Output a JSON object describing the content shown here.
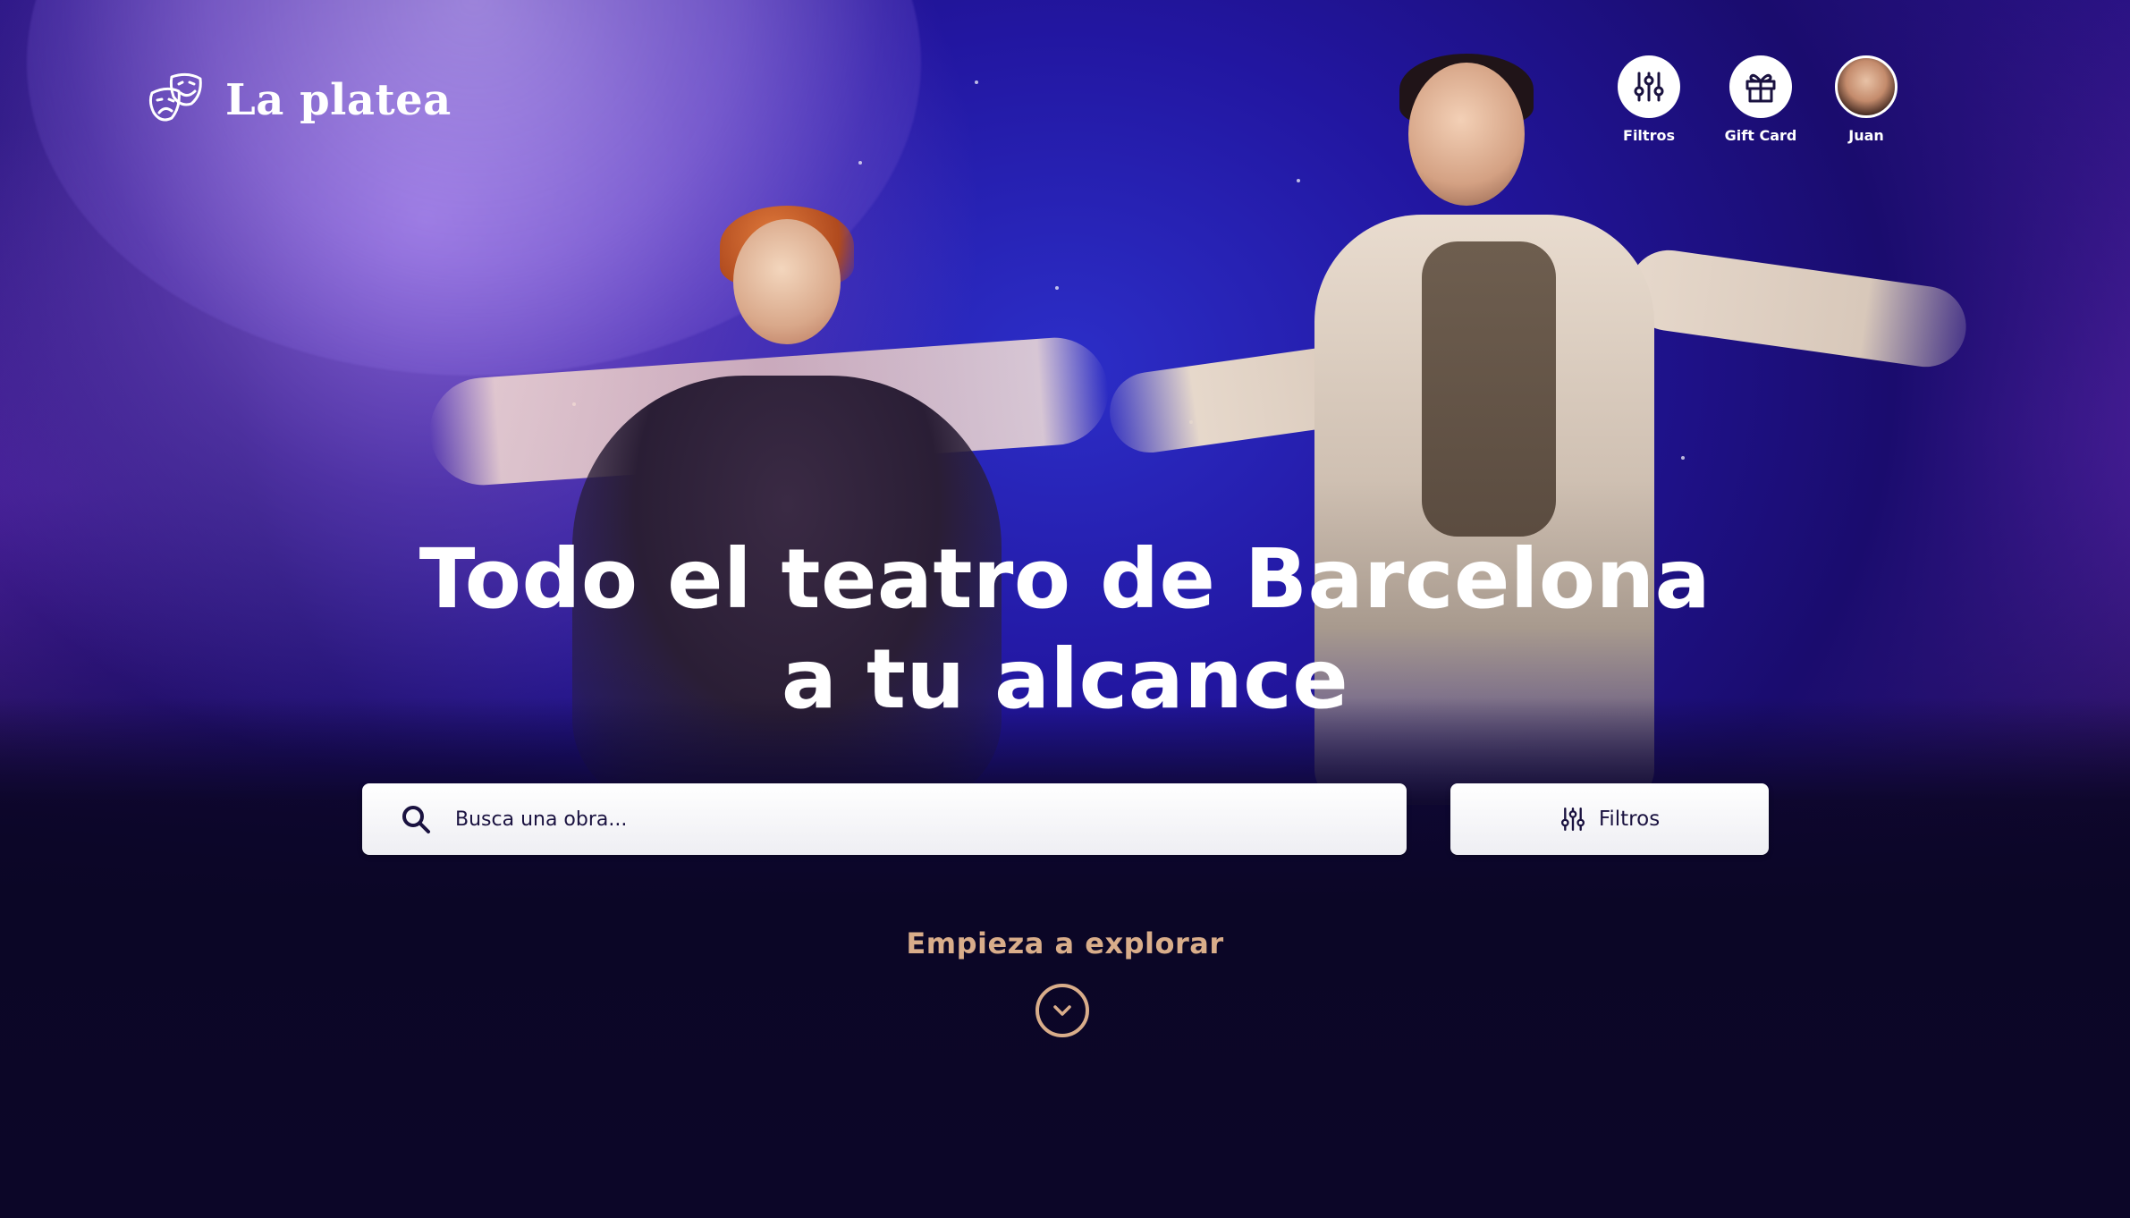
{
  "app": {
    "brand": "La platea"
  },
  "nav": {
    "items": [
      {
        "label": "Filtros",
        "icon": "sliders-icon"
      },
      {
        "label": "Gift Card",
        "icon": "gift-icon"
      },
      {
        "label": "Juan",
        "icon": "avatar"
      }
    ]
  },
  "hero": {
    "headline_line1": "Todo el teatro de Barcelona",
    "headline_line2": "a tu alcance"
  },
  "search": {
    "placeholder": "Busca una obra..."
  },
  "filters_button": {
    "label": "Filtros"
  },
  "explore": {
    "label": "Empieza a explorar"
  },
  "colors": {
    "accent": "#d9ad8a",
    "text_dark": "#1a1240",
    "background_dark": "#0c0628"
  }
}
